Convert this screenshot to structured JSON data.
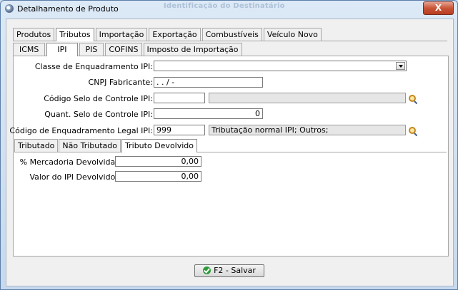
{
  "window": {
    "title": "Detalhamento de Produto",
    "blurred_title": "Identificação do Destinatário",
    "close_label": "X"
  },
  "top_tabs": [
    {
      "label": "Produtos",
      "active": false
    },
    {
      "label": "Tributos",
      "active": true
    },
    {
      "label": "Importação",
      "active": false
    },
    {
      "label": "Exportação",
      "active": false
    },
    {
      "label": "Combustíveis",
      "active": false
    },
    {
      "label": "Veículo Novo",
      "active": false
    }
  ],
  "tax_tabs": [
    {
      "label": "ICMS",
      "active": false
    },
    {
      "label": "IPI",
      "active": true
    },
    {
      "label": "PIS",
      "active": false
    },
    {
      "label": "COFINS",
      "active": false
    },
    {
      "label": "Imposto de Importação",
      "active": false
    }
  ],
  "form": {
    "classe_label": "Classe de Enquadramento IPI:",
    "classe_value": "",
    "cnpj_label": "CNPJ Fabricante:",
    "cnpj_value": " .   .   /    -",
    "selo_codigo_label": "Código Selo de Controle IPI:",
    "selo_codigo_value": "",
    "selo_codigo_desc": "",
    "selo_qtd_label": "Quant. Selo de Controle IPI:",
    "selo_qtd_value": "0",
    "enq_legal_label": "Código de Enquadramento Legal IPI:",
    "enq_legal_value": "999",
    "enq_legal_desc": "Tributação normal IPI; Outros;"
  },
  "ipi_tabs": [
    {
      "label": "Tributado",
      "active": false
    },
    {
      "label": "Não Tributado",
      "active": false
    },
    {
      "label": "Tributo Devolvido",
      "active": true
    }
  ],
  "devolvido": {
    "perc_label": "% Mercadoria Devolvida:",
    "perc_value": "0,00",
    "valor_label": "Valor do IPI Devolvido:",
    "valor_value": "0,00"
  },
  "footer": {
    "save_label": "F2 - Salvar"
  },
  "icons": [
    "app-icon",
    "search-icon",
    "check-icon",
    "dropdown-arrow-icon"
  ]
}
